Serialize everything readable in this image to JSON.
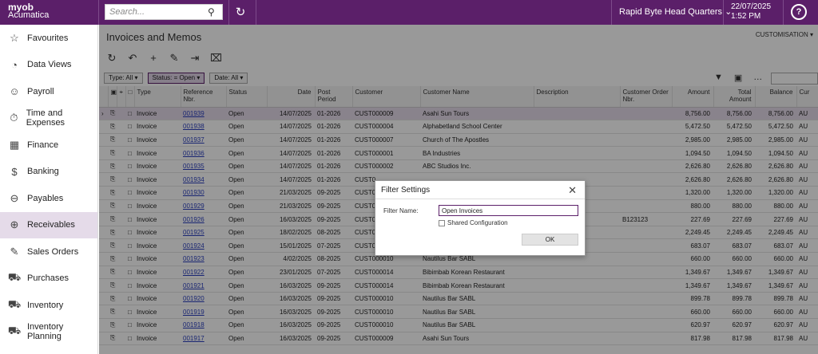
{
  "header": {
    "logo_top": "myob",
    "logo_bottom": "Acumatica",
    "search_placeholder": "Search...",
    "branch": "Rapid Byte Head Quarters",
    "date": "22/07/2025",
    "time": "1:52 PM"
  },
  "sidebar": {
    "items": [
      {
        "label": "Favourites",
        "icon": "star-icon"
      },
      {
        "label": "Data Views",
        "icon": "pie-chart-icon"
      },
      {
        "label": "Payroll",
        "icon": "person-icon"
      },
      {
        "label": "Time and Expenses",
        "icon": "stopwatch-icon"
      },
      {
        "label": "Finance",
        "icon": "calculator-icon"
      },
      {
        "label": "Banking",
        "icon": "dollar-icon"
      },
      {
        "label": "Payables",
        "icon": "minus-circle-icon"
      },
      {
        "label": "Receivables",
        "icon": "plus-circle-icon"
      },
      {
        "label": "Sales Orders",
        "icon": "edit-icon"
      },
      {
        "label": "Purchases",
        "icon": "cart-icon"
      },
      {
        "label": "Inventory",
        "icon": "truck-icon"
      },
      {
        "label": "Inventory Planning",
        "icon": "forklift-icon"
      }
    ],
    "active": "Receivables"
  },
  "page": {
    "title": "Invoices and Memos",
    "customisation": "CUSTOMISATION"
  },
  "filters": {
    "type": "Type: All",
    "status": "Status: = Open",
    "date": "Date: All"
  },
  "columns": {
    "type": "Type",
    "ref": "Reference Nbr.",
    "status": "Status",
    "date": "Date",
    "period": "Post Period",
    "customer": "Customer",
    "name": "Customer Name",
    "desc": "Description",
    "order": "Customer Order Nbr.",
    "amount": "Amount",
    "total": "Total Amount",
    "balance": "Balance",
    "cur": "Cur"
  },
  "rows": [
    {
      "type": "Invoice",
      "ref": "001939",
      "status": "Open",
      "date": "14/07/2025",
      "period": "01-2026",
      "customer": "CUST000009",
      "name": "Asahi Sun Tours",
      "order": "",
      "amount": "8,756.00",
      "total": "8,756.00",
      "balance": "8,756.00",
      "cur": "AU"
    },
    {
      "type": "Invoice",
      "ref": "001938",
      "status": "Open",
      "date": "14/07/2025",
      "period": "01-2026",
      "customer": "CUST000004",
      "name": "Alphabetland School Center",
      "order": "",
      "amount": "5,472.50",
      "total": "5,472.50",
      "balance": "5,472.50",
      "cur": "AU"
    },
    {
      "type": "Invoice",
      "ref": "001937",
      "status": "Open",
      "date": "14/07/2025",
      "period": "01-2026",
      "customer": "CUST000007",
      "name": "Church of The Apostles",
      "order": "",
      "amount": "2,985.00",
      "total": "2,985.00",
      "balance": "2,985.00",
      "cur": "AU"
    },
    {
      "type": "Invoice",
      "ref": "001936",
      "status": "Open",
      "date": "14/07/2025",
      "period": "01-2026",
      "customer": "CUST000001",
      "name": "BA Industries",
      "order": "",
      "amount": "1,094.50",
      "total": "1,094.50",
      "balance": "1,094.50",
      "cur": "AU"
    },
    {
      "type": "Invoice",
      "ref": "001935",
      "status": "Open",
      "date": "14/07/2025",
      "period": "01-2026",
      "customer": "CUST000002",
      "name": "ABC Studios Inc.",
      "order": "",
      "amount": "2,626.80",
      "total": "2,626.80",
      "balance": "2,626.80",
      "cur": "AU"
    },
    {
      "type": "Invoice",
      "ref": "001934",
      "status": "Open",
      "date": "14/07/2025",
      "period": "01-2026",
      "customer": "CUST0",
      "name": "",
      "order": "",
      "amount": "2,626.80",
      "total": "2,626.80",
      "balance": "2,626.80",
      "cur": "AU"
    },
    {
      "type": "Invoice",
      "ref": "001930",
      "status": "Open",
      "date": "21/03/2025",
      "period": "09-2025",
      "customer": "CUST0",
      "name": "",
      "order": "",
      "amount": "1,320.00",
      "total": "1,320.00",
      "balance": "1,320.00",
      "cur": "AU"
    },
    {
      "type": "Invoice",
      "ref": "001929",
      "status": "Open",
      "date": "21/03/2025",
      "period": "09-2025",
      "customer": "CUST0",
      "name": "",
      "order": "",
      "amount": "880.00",
      "total": "880.00",
      "balance": "880.00",
      "cur": "AU"
    },
    {
      "type": "Invoice",
      "ref": "001926",
      "status": "Open",
      "date": "16/03/2025",
      "period": "09-2025",
      "customer": "CUST0",
      "name": "",
      "order": "B123123",
      "amount": "227.69",
      "total": "227.69",
      "balance": "227.69",
      "cur": "AU"
    },
    {
      "type": "Invoice",
      "ref": "001925",
      "status": "Open",
      "date": "18/02/2025",
      "period": "08-2025",
      "customer": "CUST0",
      "name": "",
      "order": "",
      "amount": "2,249.45",
      "total": "2,249.45",
      "balance": "2,249.45",
      "cur": "AU"
    },
    {
      "type": "Invoice",
      "ref": "001924",
      "status": "Open",
      "date": "15/01/2025",
      "period": "07-2025",
      "customer": "CUST0",
      "name": "",
      "order": "",
      "amount": "683.07",
      "total": "683.07",
      "balance": "683.07",
      "cur": "AU"
    },
    {
      "type": "Invoice",
      "ref": "001923",
      "status": "Open",
      "date": "4/02/2025",
      "period": "08-2025",
      "customer": "CUST000010",
      "name": "Nautilus Bar SABL",
      "order": "",
      "amount": "660.00",
      "total": "660.00",
      "balance": "660.00",
      "cur": "AU"
    },
    {
      "type": "Invoice",
      "ref": "001922",
      "status": "Open",
      "date": "23/01/2025",
      "period": "07-2025",
      "customer": "CUST000014",
      "name": "Bibimbab Korean Restaurant",
      "order": "",
      "amount": "1,349.67",
      "total": "1,349.67",
      "balance": "1,349.67",
      "cur": "AU"
    },
    {
      "type": "Invoice",
      "ref": "001921",
      "status": "Open",
      "date": "16/03/2025",
      "period": "09-2025",
      "customer": "CUST000014",
      "name": "Bibimbab Korean Restaurant",
      "order": "",
      "amount": "1,349.67",
      "total": "1,349.67",
      "balance": "1,349.67",
      "cur": "AU"
    },
    {
      "type": "Invoice",
      "ref": "001920",
      "status": "Open",
      "date": "16/03/2025",
      "period": "09-2025",
      "customer": "CUST000010",
      "name": "Nautilus Bar SABL",
      "order": "",
      "amount": "899.78",
      "total": "899.78",
      "balance": "899.78",
      "cur": "AU"
    },
    {
      "type": "Invoice",
      "ref": "001919",
      "status": "Open",
      "date": "16/03/2025",
      "period": "09-2025",
      "customer": "CUST000010",
      "name": "Nautilus Bar SABL",
      "order": "",
      "amount": "660.00",
      "total": "660.00",
      "balance": "660.00",
      "cur": "AU"
    },
    {
      "type": "Invoice",
      "ref": "001918",
      "status": "Open",
      "date": "16/03/2025",
      "period": "09-2025",
      "customer": "CUST000010",
      "name": "Nautilus Bar SABL",
      "order": "",
      "amount": "620.97",
      "total": "620.97",
      "balance": "620.97",
      "cur": "AU"
    },
    {
      "type": "Invoice",
      "ref": "001917",
      "status": "Open",
      "date": "16/03/2025",
      "period": "09-2025",
      "customer": "CUST000009",
      "name": "Asahi Sun Tours",
      "order": "",
      "amount": "817.98",
      "total": "817.98",
      "balance": "817.98",
      "cur": "AU"
    }
  ],
  "dialog": {
    "title": "Filter Settings",
    "filter_label": "Filter Name:",
    "filter_value": "Open Invoices",
    "shared_label": "Shared Configuration",
    "ok_label": "OK"
  },
  "colors": {
    "brand": "#5b1f69",
    "link": "#2a3fbf",
    "active": "#e5dbe9"
  }
}
